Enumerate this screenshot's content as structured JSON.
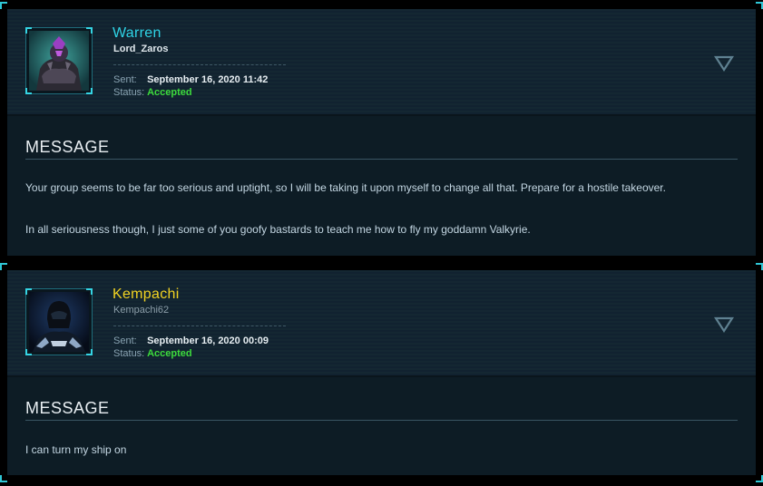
{
  "messages": [
    {
      "sender_name": "Warren",
      "sender_handle": "Lord_Zaros",
      "name_color": "#2fd4e6",
      "handle_color": "#dfe7ec",
      "avatar_icon": "armored-warrior-avatar",
      "sent_label": "Sent:",
      "sent_value": "September 16, 2020 11:42",
      "status_label": "Status:",
      "status_value": "Accepted",
      "section_title": "MESSAGE",
      "paragraphs": [
        "Your group seems to be far too serious and uptight, so I will be taking it upon myself to change all that. Prepare for a hostile takeover.",
        "In all seriousness though, I just some of you goofy bastards to teach me how to fly my goddamn Valkyrie."
      ]
    },
    {
      "sender_name": "Kempachi",
      "sender_handle": "Kempachi62",
      "name_color": "#f2d322",
      "handle_color": "#8c9ea9",
      "avatar_icon": "hooded-pilot-avatar",
      "sent_label": "Sent:",
      "sent_value": "September 16, 2020 00:09",
      "status_label": "Status:",
      "status_value": "Accepted",
      "section_title": "MESSAGE",
      "paragraphs": [
        "I can turn my ship on"
      ]
    }
  ],
  "colors": {
    "accent": "#2fc7d6",
    "status_accepted": "#3ddb3d",
    "card_background": "#0d1c25"
  },
  "icons": {
    "expand": "chevron-down-icon"
  }
}
